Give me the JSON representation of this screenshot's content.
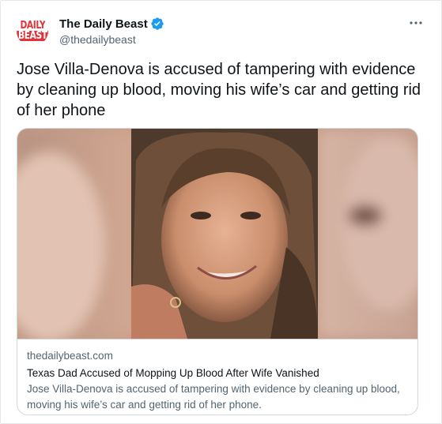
{
  "tweet": {
    "author": {
      "avatar_text_line1": "DAILY",
      "avatar_text_line2": "BEAST",
      "display_name": "The Daily Beast",
      "handle": "@thedailybeast",
      "verified": true
    },
    "more_icon": "ellipsis-icon",
    "text": "Jose Villa-Denova is accused of tampering with evidence by cleaning up blood, moving his wife’s car and getting rid of her phone",
    "card": {
      "domain": "thedailybeast.com",
      "title": "Texas Dad Accused of Mopping Up Blood After Wife Vanished",
      "description": "Jose Villa-Denova is accused of tampering with evidence by cleaning up blood, moving his wife’s car and getting rid of her phone."
    }
  },
  "colors": {
    "brand_red": "#e0333a",
    "verified_blue": "#1d9bf0",
    "text_primary": "#0f1419",
    "text_secondary": "#536471",
    "border": "#cfd9de"
  }
}
